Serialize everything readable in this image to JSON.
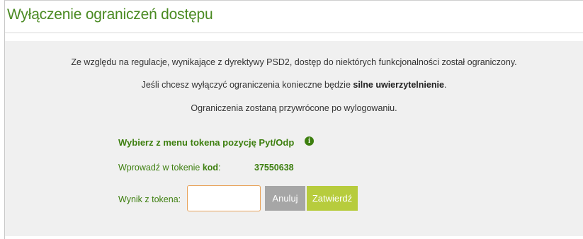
{
  "header": {
    "title": "Wyłączenie ograniczeń dostępu"
  },
  "messages": {
    "line1": "Ze względu na regulacje, wynikające z dyrektywy PSD2, dostęp do niektórych funkcjonalności został ograniczony.",
    "line2_prefix": "Jeśli chcesz wyłączyć ograniczenia konieczne będzie ",
    "line2_bold": "silne uwierzytelnienie",
    "line2_suffix": ".",
    "line3": "Ograniczenia zostaną przywrócone po wylogowaniu."
  },
  "token": {
    "instruction": "Wybierz z menu tokena pozycję Pyt/Odp",
    "info_icon": "info-icon",
    "code_label_prefix": "Wprowadź w tokenie ",
    "code_label_bold": "kod",
    "code_label_suffix": ":",
    "code_value": "37550638",
    "result_label": "Wynik z tokena:",
    "result_value": "",
    "result_placeholder": ""
  },
  "buttons": {
    "cancel": "Anuluj",
    "confirm": "Zatwierdź"
  },
  "colors": {
    "accent_green": "#3d7f0f",
    "title_green": "#4a8a22",
    "confirm_button": "#b7cc3d",
    "cancel_button": "#a6a6a6",
    "input_border": "#e8a35a",
    "panel_background": "#f0f0f0"
  }
}
